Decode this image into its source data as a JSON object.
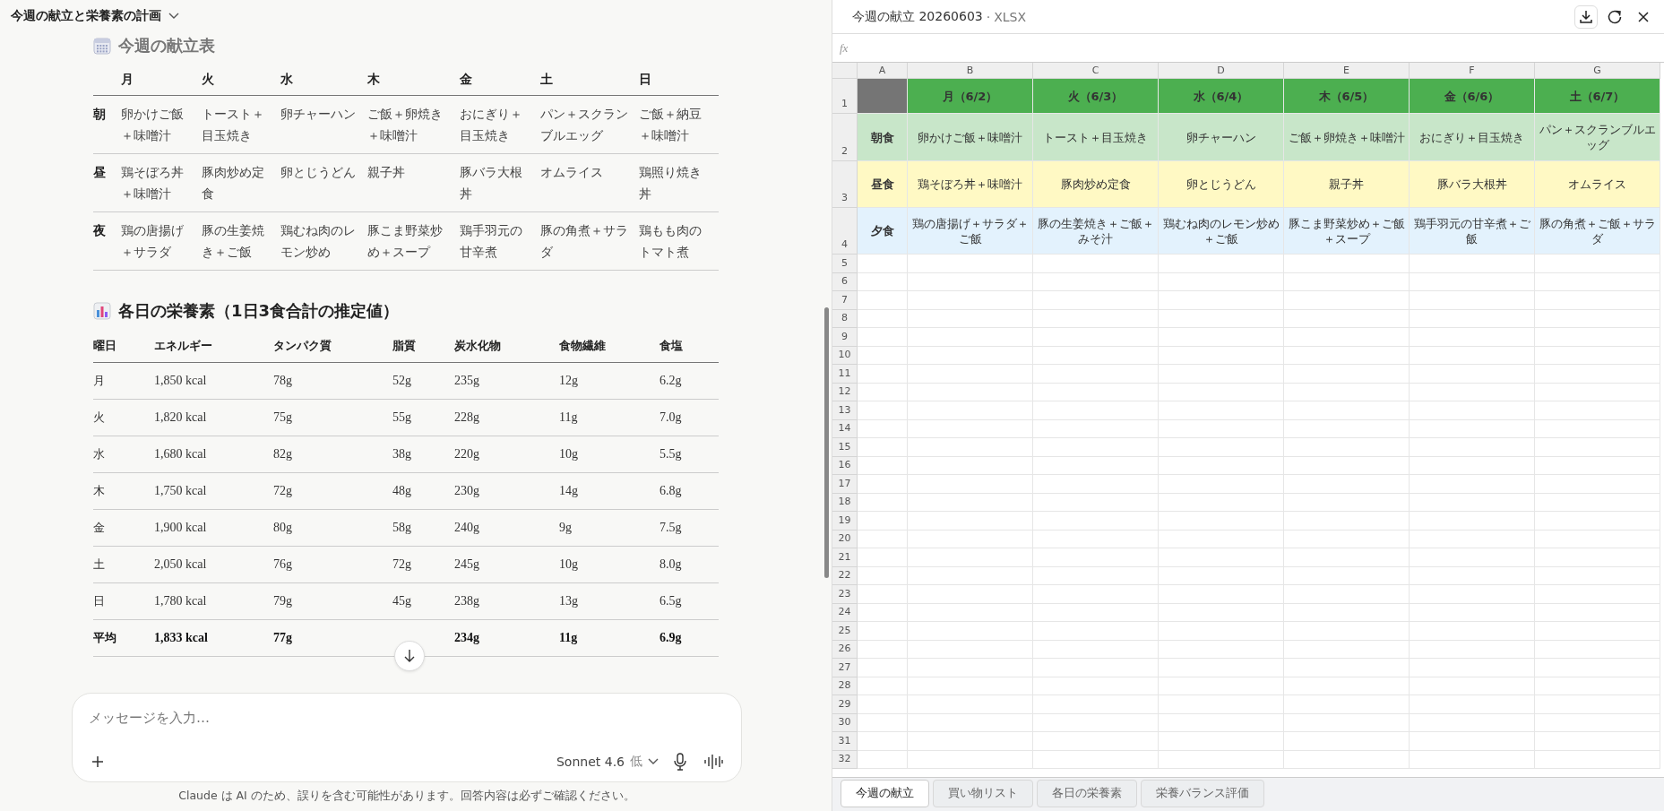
{
  "conversation": {
    "title": "今週の献立と栄養素の計画"
  },
  "menu_table": {
    "heading": "今週の献立表",
    "days": [
      "月",
      "火",
      "水",
      "木",
      "金",
      "土",
      "日"
    ],
    "rows": [
      {
        "label": "朝",
        "cells": [
          "卵かけご飯＋味噌汁",
          "トースト＋目玉焼き",
          "卵チャーハン",
          "ご飯＋卵焼き＋味噌汁",
          "おにぎり＋目玉焼き",
          "パン＋スクランブルエッグ",
          "ご飯＋納豆＋味噌汁"
        ]
      },
      {
        "label": "昼",
        "cells": [
          "鶏そぼろ丼＋味噌汁",
          "豚肉炒め定食",
          "卵とじうどん",
          "親子丼",
          "豚バラ大根丼",
          "オムライス",
          "鶏照り焼き丼"
        ]
      },
      {
        "label": "夜",
        "cells": [
          "鶏の唐揚げ＋サラダ",
          "豚の生姜焼き＋ご飯",
          "鶏むね肉のレモン炒め",
          "豚こま野菜炒め＋スープ",
          "鶏手羽元の甘辛煮",
          "豚の角煮＋サラダ",
          "鶏もも肉のトマト煮"
        ]
      }
    ]
  },
  "nutrition_table": {
    "heading": "各日の栄養素（1日3食合計の推定値）",
    "columns": [
      "曜日",
      "エネルギー",
      "タンパク質",
      "脂質",
      "炭水化物",
      "食物繊維",
      "食塩"
    ],
    "rows": [
      {
        "kind": "day",
        "cells": [
          "月",
          "1,850 kcal",
          "78g",
          "52g",
          "235g",
          "12g",
          "6.2g"
        ]
      },
      {
        "kind": "day",
        "cells": [
          "火",
          "1,820 kcal",
          "75g",
          "55g",
          "228g",
          "11g",
          "7.0g"
        ]
      },
      {
        "kind": "day",
        "cells": [
          "水",
          "1,680 kcal",
          "82g",
          "38g",
          "220g",
          "10g",
          "5.5g"
        ]
      },
      {
        "kind": "day",
        "cells": [
          "木",
          "1,750 kcal",
          "72g",
          "48g",
          "230g",
          "14g",
          "6.8g"
        ]
      },
      {
        "kind": "day",
        "cells": [
          "金",
          "1,900 kcal",
          "80g",
          "58g",
          "240g",
          "9g",
          "7.5g"
        ]
      },
      {
        "kind": "day",
        "cells": [
          "土",
          "2,050 kcal",
          "76g",
          "72g",
          "245g",
          "10g",
          "8.0g"
        ]
      },
      {
        "kind": "day",
        "cells": [
          "日",
          "1,780 kcal",
          "79g",
          "45g",
          "238g",
          "13g",
          "6.5g"
        ]
      },
      {
        "kind": "average",
        "cells": [
          "平均",
          "1,833 kcal",
          "77g",
          null,
          "234g",
          "11g",
          "6.9g"
        ]
      }
    ]
  },
  "composer": {
    "placeholder": "メッセージを入力…",
    "model": "Sonnet 4.6",
    "effort": "低"
  },
  "disclaimer": "Claude は AI のため、誤りを含む可能性があります。回答内容は必ずご確認ください。",
  "spreadsheet": {
    "title": "今週の献立 20260603",
    "separator": "·",
    "format": "XLSX",
    "formula_label": "fx",
    "columns": [
      "A",
      "B",
      "C",
      "D",
      "E",
      "F",
      "G"
    ],
    "rows": [
      {
        "number": "1",
        "kind": "header",
        "color": "#4caf50",
        "cells": [
          "",
          "月（6/2）",
          "火（6/3）",
          "水（6/4）",
          "木（6/5）",
          "金（6/6）",
          "土（6/7）"
        ]
      },
      {
        "number": "2",
        "kind": "meal",
        "color": "#c8e6c9",
        "cells": [
          "朝食",
          "卵かけご飯＋味噌汁",
          "トースト＋目玉焼き",
          "卵チャーハン",
          "ご飯＋卵焼き＋味噌汁",
          "おにぎり＋目玉焼き",
          "パン＋スクランブルエッグ"
        ]
      },
      {
        "number": "3",
        "kind": "meal",
        "color": "#fff9c4",
        "cells": [
          "昼食",
          "鶏そぼろ丼＋味噌汁",
          "豚肉炒め定食",
          "卵とじうどん",
          "親子丼",
          "豚バラ大根丼",
          "オムライス"
        ]
      },
      {
        "number": "4",
        "kind": "meal",
        "color": "#e3f2fd",
        "cells": [
          "夕食",
          "鶏の唐揚げ＋サラダ＋ご飯",
          "豚の生姜焼き＋ご飯＋みそ汁",
          "鶏むね肉のレモン炒め＋ご飯",
          "豚こま野菜炒め＋ご飯＋スープ",
          "鶏手羽元の甘辛煮＋ご飯",
          "豚の角煮＋ご飯＋サラダ"
        ]
      }
    ],
    "empty_rows": [
      "5",
      "6",
      "7",
      "8",
      "9",
      "10",
      "11",
      "12",
      "13",
      "14",
      "15",
      "16",
      "17",
      "18",
      "19",
      "20",
      "21",
      "22",
      "23",
      "24",
      "25",
      "26",
      "27",
      "28",
      "29",
      "30",
      "31",
      "32"
    ],
    "sheets": [
      {
        "label": "今週の献立",
        "selected": true
      },
      {
        "label": "買い物リスト",
        "selected": false
      },
      {
        "label": "各日の栄養素",
        "selected": false
      },
      {
        "label": "栄養バランス評価",
        "selected": false
      }
    ]
  }
}
